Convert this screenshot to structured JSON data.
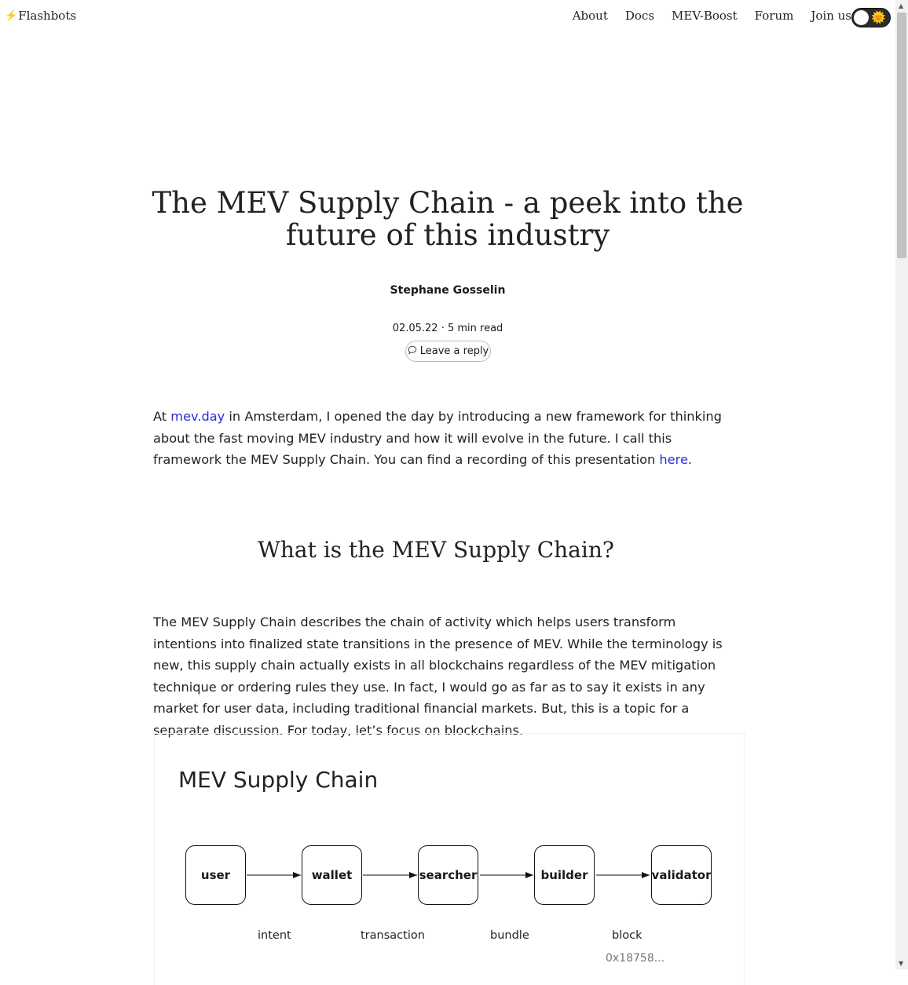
{
  "nav": {
    "brand_icon": "⚡",
    "brand": "Flashbots",
    "links": [
      "About",
      "Docs",
      "MEV-Boost",
      "Forum",
      "Join us"
    ],
    "theme_icon": "🌞"
  },
  "post": {
    "title": "The MEV Supply Chain - a peek into the future of this industry",
    "author": "Stephane Gosselin",
    "meta": "02.05.22 · 5 min read",
    "reply_label": "Leave a reply",
    "p1": {
      "before_link": "At ",
      "link1": "mev.day",
      "middle": " in Amsterdam, I opened the day by introducing a new framework for thinking about the fast moving MEV industry and how it will evolve in the future. I call this framework the MEV Supply Chain. You can find a recording of this presentation ",
      "link2": "here",
      "after": "."
    },
    "h2": "What is the MEV Supply Chain?",
    "p2": "The MEV Supply Chain describes the chain of activity which helps users transform intentions into finalized state transitions in the presence of MEV. While the terminology is new, this supply chain actually exists in all blockchains regardless of the MEV mitigation technique or ordering rules they use. In fact, I would go as far as to say it exists in any market for user data, including traditional financial markets. But, this is a topic for a separate discussion. For today, let’s focus on blockchains."
  },
  "figure": {
    "title": "MEV Supply Chain",
    "nodes": [
      "user",
      "wallet",
      "searcher",
      "builder",
      "validator"
    ],
    "edges": [
      "intent",
      "transaction",
      "bundle",
      "block"
    ],
    "hash": "0x18758..."
  }
}
